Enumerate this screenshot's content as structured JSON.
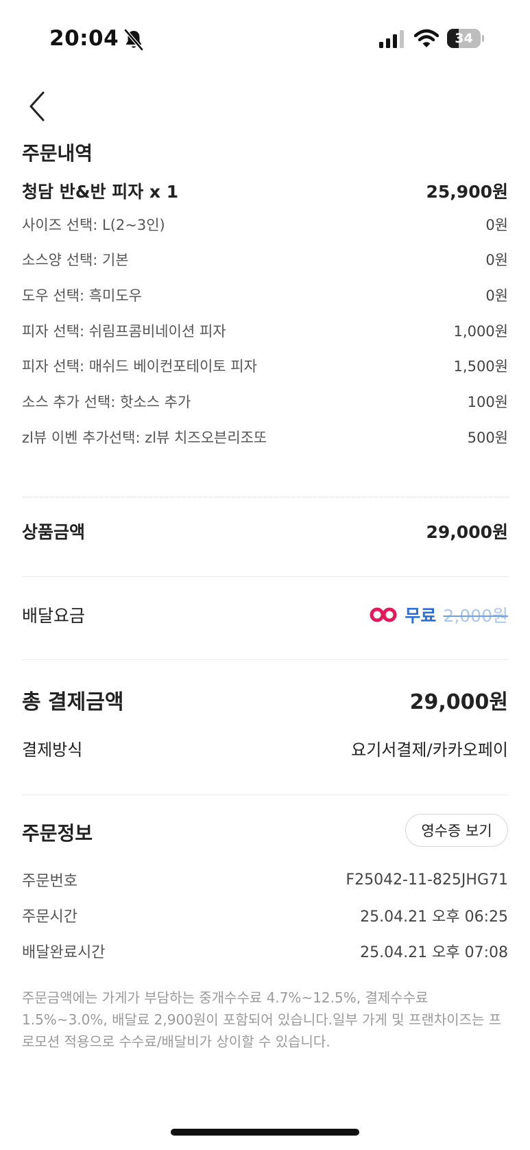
{
  "status_bar": {
    "time": "20:04",
    "battery": "34",
    "battery_level": 0.34,
    "icons": [
      "bell-slash-icon",
      "cellular-signal-icon",
      "wifi-icon",
      "battery-icon"
    ]
  },
  "nav": {
    "back_icon": "chevron-left-icon"
  },
  "order": {
    "section_title": "주문내역",
    "item": {
      "name": "청담 반&반 피자 x 1",
      "price": "25,900원"
    },
    "options": [
      {
        "label": "사이즈 선택: L(2~3인)",
        "price": "0원"
      },
      {
        "label": "소스양 선택: 기본",
        "price": "0원"
      },
      {
        "label": "도우 선택: 흑미도우",
        "price": "0원"
      },
      {
        "label": "피자 선택: 쉬림프콤비네이션 피자",
        "price": "1,000원"
      },
      {
        "label": "피자 선택: 매쉬드 베이컨포테이토 피자",
        "price": "1,500원"
      },
      {
        "label": "소스 추가 선택: 핫소스 추가",
        "price": "100원"
      },
      {
        "label": "zl뷰 이벤 추가선택: zl뷰 치즈오븐리조또",
        "price": "500원"
      }
    ]
  },
  "subtotal": {
    "label": "상품금액",
    "value": "29,000원"
  },
  "delivery": {
    "label": "배달요금",
    "badge_icon": "yopass-logo-icon",
    "free_label": "무료",
    "original_fee": "2,000원",
    "colors": {
      "badge": "#e5165a",
      "free": "#2a6fd6",
      "strike": "#a8c6ee"
    }
  },
  "total": {
    "label": "총 결제금액",
    "value": "29,000원"
  },
  "payment": {
    "label": "결제방식",
    "value": "요기서결제/카카오페이"
  },
  "order_info": {
    "title": "주문정보",
    "receipt_button": "영수증 보기",
    "rows": [
      {
        "label": "주문번호",
        "value": "F25042-11-825JHG71"
      },
      {
        "label": "주문시간",
        "value": "25.04.21 오후 06:25"
      },
      {
        "label": "배달완료시간",
        "value": "25.04.21 오후 07:08"
      }
    ]
  },
  "notice": "주문금액에는 가게가 부담하는 중개수수료 4.7%~12.5%, 결제수수료 1.5%~3.0%, 배달료 2,900원이 포함되어 있습니다.일부 가게 및 프랜차이즈는 프로모션 적용으로 수수료/배달비가 상이할 수 있습니다."
}
